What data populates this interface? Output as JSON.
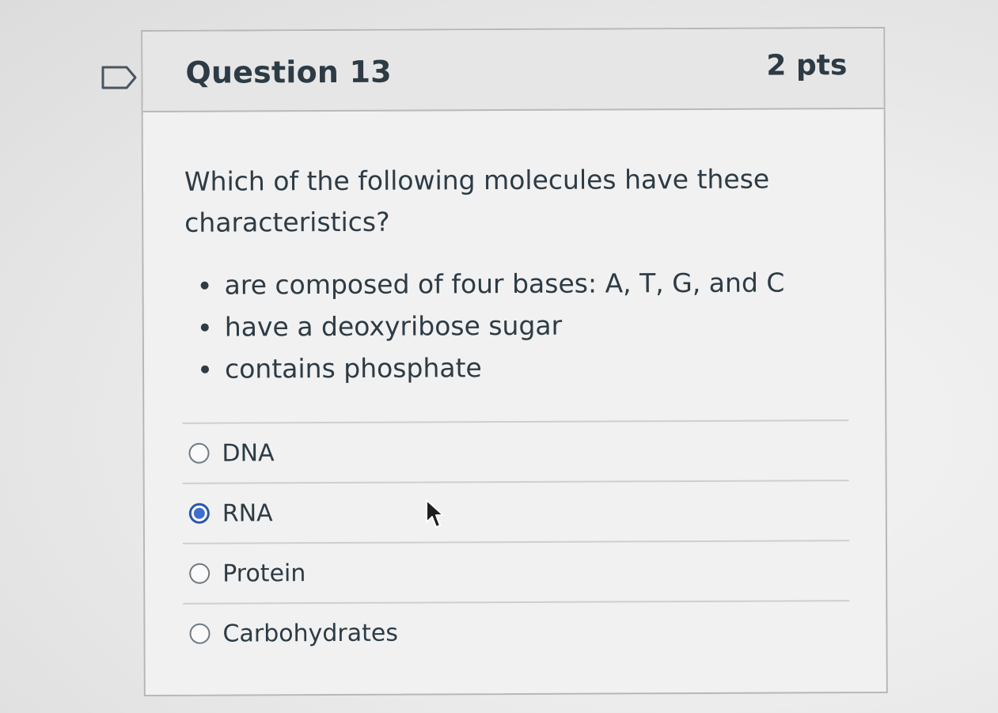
{
  "question": {
    "title": "Question 13",
    "points": "2 pts",
    "prompt": "Which of the following molecules have these characteristics?",
    "characteristics": [
      "are composed of four bases: A, T, G, and C",
      "have a deoxyribose sugar",
      "contains phosphate"
    ]
  },
  "answers": [
    {
      "label": "DNA",
      "selected": false
    },
    {
      "label": "RNA",
      "selected": true
    },
    {
      "label": "Protein",
      "selected": false
    },
    {
      "label": "Carbohydrates",
      "selected": false
    }
  ],
  "icons": {
    "flag": "flag-question-icon",
    "cursor": "mouse-pointer-icon"
  },
  "colors": {
    "text": "#2d3b45",
    "selected_radio": "#3c6fd0",
    "border": "#b7b7b7"
  }
}
